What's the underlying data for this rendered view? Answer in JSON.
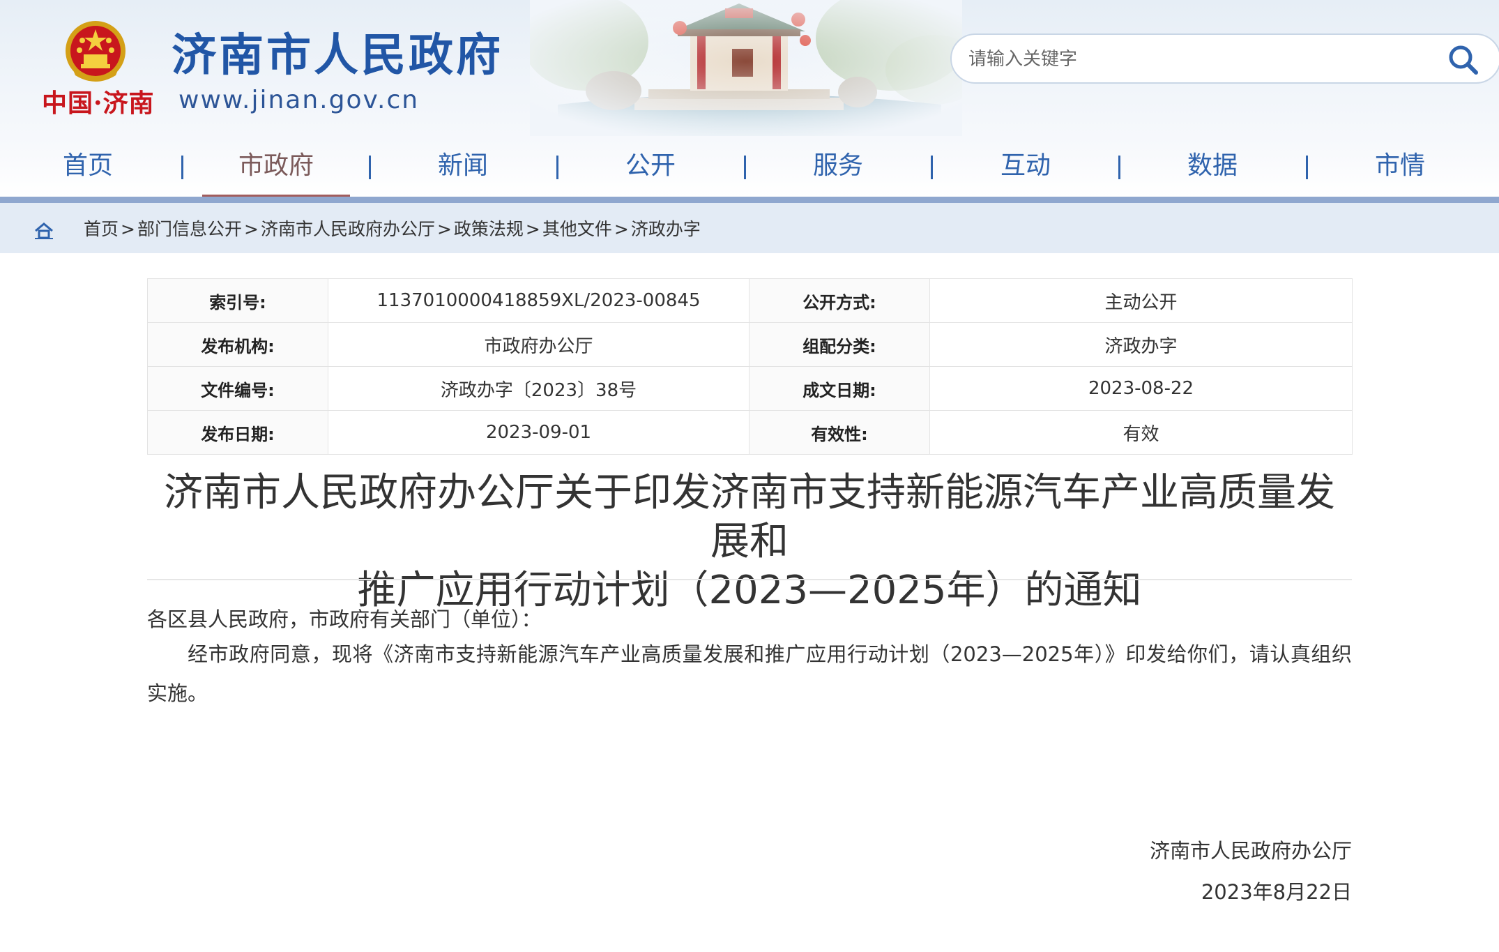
{
  "header": {
    "emblem_caption": "中国·济南",
    "site_title": "济南市人民政府",
    "site_url": "www.jinan.gov.cn",
    "search_placeholder": "请输入关键字"
  },
  "nav": {
    "items": [
      {
        "label": "首页"
      },
      {
        "label": "市政府"
      },
      {
        "label": "新闻"
      },
      {
        "label": "公开"
      },
      {
        "label": "服务"
      },
      {
        "label": "互动"
      },
      {
        "label": "数据"
      },
      {
        "label": "市情"
      }
    ],
    "active_index": 1
  },
  "breadcrumb": {
    "items": [
      "首页",
      "部门信息公开",
      "济南市人民政府办公厅",
      "政策法规",
      "其他文件",
      "济政办字"
    ],
    "separator": ">"
  },
  "meta": {
    "rows": [
      {
        "k1": "索引号:",
        "v1": "113701000041885‌9XL/2023-00845",
        "k2": "公开方式:",
        "v2": "主动公开"
      },
      {
        "k1": "发布机构:",
        "v1": "市政府办公厅",
        "k2": "组配分类:",
        "v2": "济政办字"
      },
      {
        "k1": "文件编号:",
        "v1": "济政办字〔2023〕38号",
        "k2": "成文日期:",
        "v2": "2023-08-22"
      },
      {
        "k1": "发布日期:",
        "v1": "2023-09-01",
        "k2": "有效性:",
        "v2": "有效"
      }
    ]
  },
  "article": {
    "title_line1": "济南市人民政府办公厅关于印发济南市支持新能源汽车产业高质量发展和",
    "title_line2": "推广应用行动计划（2023—2025年）的通知",
    "salutation": "各区县人民政府，市政府有关部门（单位）：",
    "body": "经市政府同意，现将《济南市支持新能源汽车产业高质量发展和推广应用行动计划（2023—2025年）》印发给你们，请认真组织实施。",
    "signature_org": "济南市人民政府办公厅",
    "signature_date": "2023年8月22日"
  },
  "colors": {
    "nav_text": "#2f63ad",
    "title_blue": "#2156a6",
    "emblem_red": "#c8161d",
    "breadcrumb_bg": "#e3ebf5"
  }
}
